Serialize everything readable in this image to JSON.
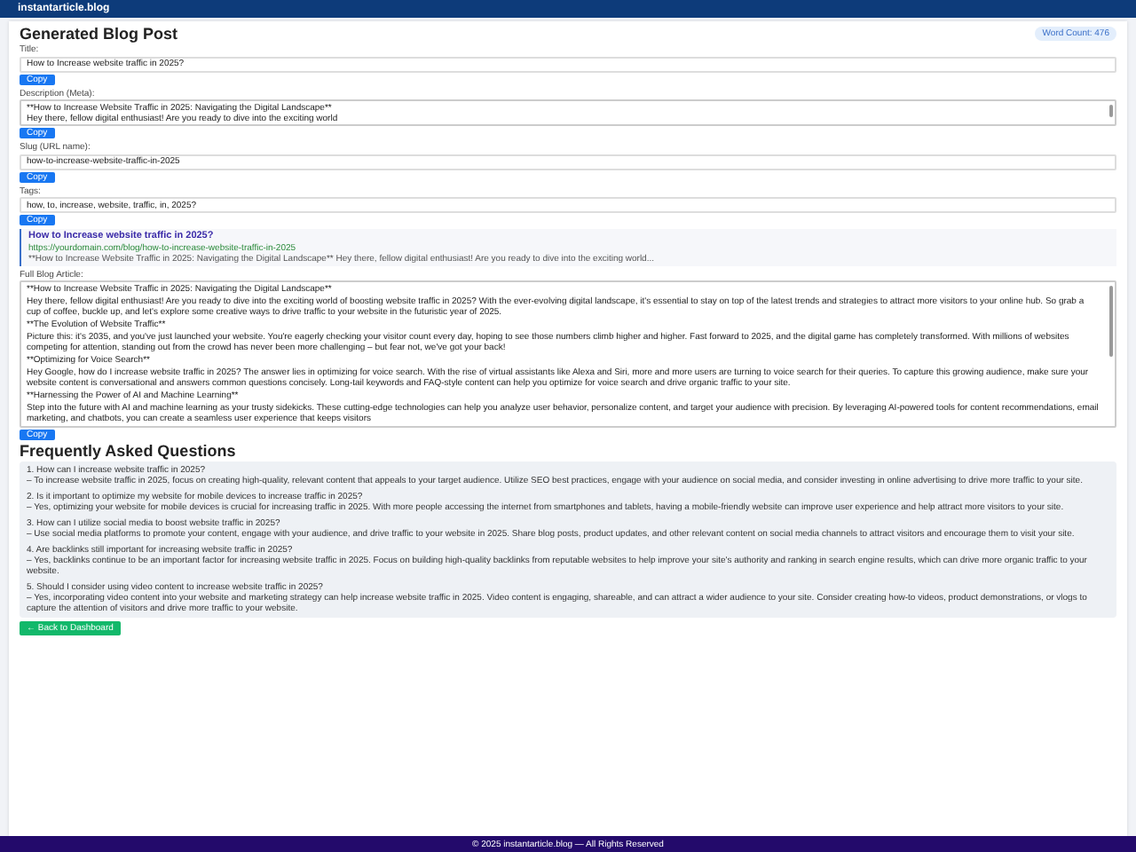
{
  "navbar": {
    "brand": "instantarticle.blog"
  },
  "page": {
    "heading": "Generated Blog Post",
    "word_count": "Word Count: 476"
  },
  "fields": [
    {
      "kind": "input",
      "label": "Title:",
      "value": "How to Increase website traffic in 2025?",
      "button": "Copy"
    },
    {
      "kind": "textarea",
      "label": "Description (Meta):",
      "lines": [
        "**How to Increase Website Traffic in 2025: Navigating the Digital Landscape**",
        "Hey there, fellow digital enthusiast! Are you ready to dive into the exciting world"
      ],
      "button": "Copy"
    },
    {
      "kind": "input",
      "label": "Slug (URL name):",
      "value": "how-to-increase-website-traffic-in-2025",
      "button": "Copy"
    },
    {
      "kind": "input",
      "label": "Tags:",
      "value": "how, to, increase, website, traffic, in, 2025?",
      "button": "Copy"
    }
  ],
  "preview": {
    "title": "How to Increase website traffic in 2025?",
    "url": "https://yourdomain.com/blog/how-to-increase-website-traffic-in-2025",
    "snippet": "**How to Increase Website Traffic in 2025: Navigating the Digital Landscape** Hey there, fellow digital enthusiast! Are you ready to dive into the exciting world..."
  },
  "article": {
    "label": "Full Blog Article:",
    "paragraphs": [
      "**How to Increase Website Traffic in 2025: Navigating the Digital Landscape**",
      "Hey there, fellow digital enthusiast! Are you ready to dive into the exciting world of boosting website traffic in 2025? With the ever-evolving digital landscape, it's essential to stay on top of the latest trends and strategies to attract more visitors to your online hub. So grab a cup of coffee, buckle up, and let's explore some creative ways to drive traffic to your website in the futuristic year of 2025.",
      "**The Evolution of Website Traffic**",
      "Picture this: it's 2035, and you've just launched your website. You're eagerly checking your visitor count every day, hoping to see those numbers climb higher and higher. Fast forward to 2025, and the digital game has completely transformed. With millions of websites competing for attention, standing out from the crowd has never been more challenging – but fear not, we've got your back!",
      "**Optimizing for Voice Search**",
      "Hey Google, how do I increase website traffic in 2025? The answer lies in optimizing for voice search. With the rise of virtual assistants like Alexa and Siri, more and more users are turning to voice search for their queries. To capture this growing audience, make sure your website content is conversational and answers common questions concisely. Long-tail keywords and FAQ-style content can help you optimize for voice search and drive organic traffic to your site.",
      "**Harnessing the Power of AI and Machine Learning**",
      "Step into the future with AI and machine learning as your trusty sidekicks. These cutting-edge technologies can help you analyze user behavior, personalize content, and target your audience with precision. By leveraging AI-powered tools for content recommendations, email marketing, and chatbots, you can create a seamless user experience that keeps visitors"
    ],
    "button": "Copy"
  },
  "faq": {
    "heading": "Frequently Asked Questions",
    "items": [
      {
        "question": "1. How can I increase website traffic in 2025?",
        "answer": "– To increase website traffic in 2025, focus on creating high-quality, relevant content that appeals to your target audience. Utilize SEO best practices, engage with your audience on social media, and consider investing in online advertising to drive more traffic to your site."
      },
      {
        "question": "2. Is it important to optimize my website for mobile devices to increase traffic in 2025?",
        "answer": "– Yes, optimizing your website for mobile devices is crucial for increasing traffic in 2025. With more people accessing the internet from smartphones and tablets, having a mobile-friendly website can improve user experience and help attract more visitors to your site."
      },
      {
        "question": "3. How can I utilize social media to boost website traffic in 2025?",
        "answer": "– Use social media platforms to promote your content, engage with your audience, and drive traffic to your website in 2025. Share blog posts, product updates, and other relevant content on social media channels to attract visitors and encourage them to visit your site."
      },
      {
        "question": "4. Are backlinks still important for increasing website traffic in 2025?",
        "answer": "– Yes, backlinks continue to be an important factor for increasing website traffic in 2025. Focus on building high-quality backlinks from reputable websites to help improve your site's authority and ranking in search engine results, which can drive more organic traffic to your website."
      },
      {
        "question": "5. Should I consider using video content to increase website traffic in 2025?",
        "answer": "– Yes, incorporating video content into your website and marketing strategy can help increase website traffic in 2025. Video content is engaging, shareable, and can attract a wider audience to your site. Consider creating how-to videos, product demonstrations, or vlogs to capture the attention of visitors and drive more traffic to your website."
      }
    ]
  },
  "back_button": "← Back to Dashboard",
  "footer": "© 2025 instantarticle.blog — All Rights Reserved"
}
